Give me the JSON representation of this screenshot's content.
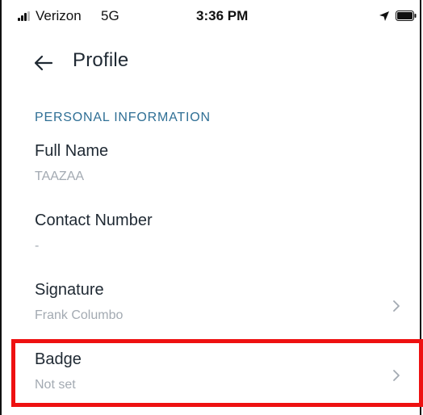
{
  "status_bar": {
    "carrier": "Verizon",
    "network": "5G",
    "time": "3:36 PM"
  },
  "header": {
    "title": "Profile",
    "back_icon": "arrow-left-icon"
  },
  "section": {
    "title": "PERSONAL INFORMATION"
  },
  "fields": {
    "full_name": {
      "label": "Full Name",
      "value": "TAAZAA"
    },
    "contact_number": {
      "label": "Contact Number",
      "value": "-"
    },
    "signature": {
      "label": "Signature",
      "value": "Frank Columbo"
    },
    "badge": {
      "label": "Badge",
      "value": "Not set"
    }
  },
  "colors": {
    "accent": "#2f6f95",
    "muted_text": "#a3aab2",
    "highlight": "#ee1111"
  }
}
